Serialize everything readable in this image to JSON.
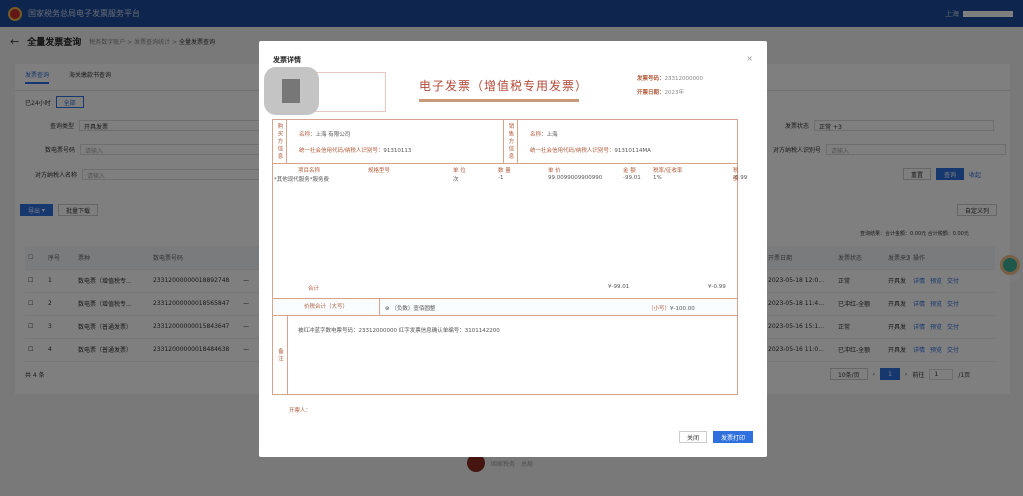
{
  "header": {
    "site_title": "国家税务总局电子发票服务平台",
    "user_prefix": "上海"
  },
  "page": {
    "back_icon": "arrow-left",
    "title": "全量发票查询",
    "breadcrumb": [
      "税务数字账户",
      "发票查询统计",
      "全量发票查询"
    ]
  },
  "tabs": [
    "发票查询",
    "海关缴款书查询"
  ],
  "filters": {
    "scope_label": "已24小时",
    "scope_button": "全部",
    "query_type_label": "查询类型",
    "query_type_value": "开具发票",
    "invoice_no_label": "数电票号码",
    "invoice_no_placeholder": "请输入",
    "buyer_label": "对方纳税人名称",
    "buyer_placeholder": "请输入",
    "status_label": "发票状态",
    "status_value": "正常",
    "status_extra": "+3",
    "taxid_label": "对方纳税人识别号",
    "taxid_placeholder": "请输入",
    "reset": "重置",
    "query": "查询",
    "collapse": "收起"
  },
  "toolbar": {
    "export": "导出",
    "batch_download": "批量下载",
    "custom_columns": "自定义列",
    "summary": "查询结果：合计金额：0.00元  合计税额：0.00元"
  },
  "table": {
    "headers": [
      "",
      "序号",
      "票种",
      "数电票号码",
      "",
      "开票日期",
      "发票状态",
      "发票来源",
      "操作"
    ],
    "rows": [
      {
        "no": "1",
        "type": "数电票（增值税专...",
        "number": "23312000000018892748",
        "date": "2023-05-18 12:0...",
        "status": "正常",
        "source": "开具发"
      },
      {
        "no": "2",
        "type": "数电票（增值税专...",
        "number": "23312000000018565847",
        "date": "2023-05-18 11:4...",
        "status": "已冲红-全额",
        "source": "开具发"
      },
      {
        "no": "3",
        "type": "数电票（普通发票）",
        "number": "23312000000015843647",
        "date": "2023-05-16 15:1...",
        "status": "正常",
        "source": "开具发"
      },
      {
        "no": "4",
        "type": "数电票（普通发票）",
        "number": "23312000000018484638",
        "date": "2023-05-16 11:0...",
        "status": "已冲红-全额",
        "source": "开具发"
      }
    ],
    "actions": [
      "详情",
      "预览",
      "交付"
    ],
    "total": "共 4 条",
    "pagination": {
      "page_size": "10条/页",
      "current": "1",
      "goto_label": "前往",
      "goto_value": "1",
      "pages": "/1页"
    }
  },
  "assistant": {
    "label": "智能咨询"
  },
  "footer": {
    "left": "国家税务",
    "right": "总局"
  },
  "modal": {
    "title": "发票详情",
    "close": "×",
    "invoice_title": "电子发票（增值税专用发票）",
    "invoice_no_label": "发票号码：",
    "invoice_no": "23312000000",
    "date_label": "开票日期：",
    "date": "2023年",
    "buyer_header": "购买方信息",
    "buyer_name_label": "名称：",
    "buyer_name": "上海 有限公司",
    "buyer_tax_label": "统一社会信用代码/纳税人识别号：",
    "buyer_tax": "91310113",
    "seller_header": "销售方信息",
    "seller_name_label": "名称：",
    "seller_name": "上海",
    "seller_tax_label": "统一社会信用代码/纳税人识别号：",
    "seller_tax": "91310114MA",
    "item_headers": [
      "项目名称",
      "规格型号",
      "单 位",
      "数 量",
      "单 价",
      "金 额",
      "税率/征收率",
      "税 额"
    ],
    "items": [
      {
        "name": "*其他现代服务*服务费",
        "spec": "",
        "unit": "次",
        "qty": "-1",
        "price": "99.0099009900990",
        "amount": "-99.01",
        "rate": "1%",
        "tax": "-0.99"
      }
    ],
    "total_label": "合计",
    "total_amount": "¥-99.01",
    "total_tax": "¥-0.99",
    "grand_label": "价税合计（大写）",
    "grand_upper": "（负数）壹佰圆整",
    "grand_lower_label": "（小写）",
    "grand_lower": "¥-100.00",
    "remark_header": "备注",
    "remark": "被红冲蓝字数电票号码：23312000000  红字发票信息确认单编号：3101142200",
    "issuer_label": "开票人：",
    "issuer": "",
    "close_button": "关闭",
    "print_button": "发票打印"
  }
}
